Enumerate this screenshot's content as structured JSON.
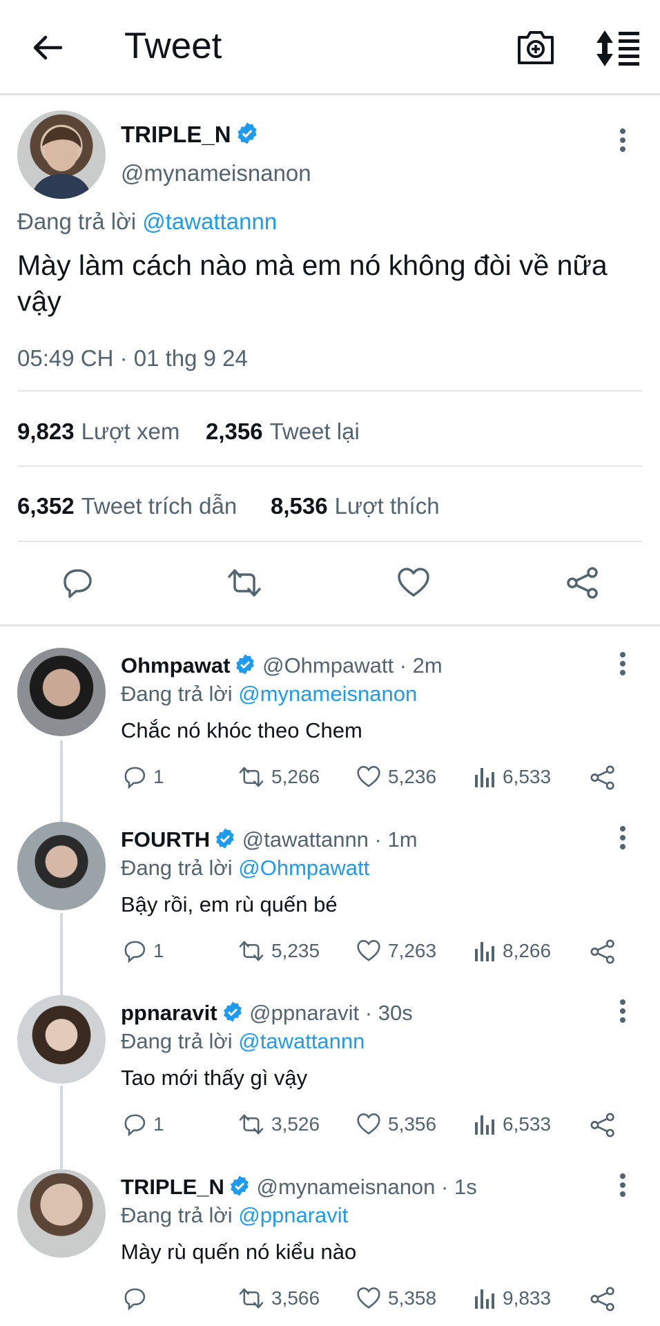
{
  "header": {
    "title": "Tweet"
  },
  "tweet": {
    "name": "TRIPLE_N",
    "handle": "@mynameisnanon",
    "replying_prefix": "Đang trả lời",
    "replying_to": "@tawattannn",
    "text": "Mày làm cách nào mà em nó không đòi về nữa vậy",
    "timestamp": "05:49 CH · 01 thg 9 24",
    "stats": {
      "views_count": "9,823",
      "views_label": "Lượt xem",
      "retweets_count": "2,356",
      "retweets_label": "Tweet lại",
      "quotes_count": "6,352",
      "quotes_label": "Tweet trích dẫn",
      "likes_count": "8,536",
      "likes_label": "Lượt thích"
    }
  },
  "replies": [
    {
      "name": "Ohmpawat",
      "handle": "@Ohmpawatt",
      "time": "· 2m",
      "replying_prefix": "Đang trả lời",
      "replying_to": "@mynameisnanon",
      "text": "Chắc nó khóc theo Chem",
      "replies": "1",
      "retweets": "5,266",
      "likes": "5,236",
      "views": "6,533"
    },
    {
      "name": "FOURTH",
      "handle": "@tawattannn",
      "time": "· 1m",
      "replying_prefix": "Đang trả lời",
      "replying_to": "@Ohmpawatt",
      "text": "Bậy rồi, em rù quến bé",
      "replies": "1",
      "retweets": "5,235",
      "likes": "7,263",
      "views": "8,266"
    },
    {
      "name": "ppnaravit",
      "handle": "@ppnaravit",
      "time": "· 30s",
      "replying_prefix": "Đang trả lời",
      "replying_to": "@tawattannn",
      "text": "Tao mới thấy gì vậy",
      "replies": "1",
      "retweets": "3,526",
      "likes": "5,356",
      "views": "6,533"
    },
    {
      "name": "TRIPLE_N",
      "handle": "@mynameisnanon",
      "time": "· 1s",
      "replying_prefix": "Đang trả lời",
      "replying_to": "@ppnaravit",
      "text": "Mày rù quến nó kiểu nào",
      "replies": "",
      "retweets": "3,566",
      "likes": "5,358",
      "views": "9,833"
    }
  ],
  "colors": {
    "accent": "#1d9bf0",
    "secondary_text": "#536471",
    "primary_text": "#0f1419"
  }
}
